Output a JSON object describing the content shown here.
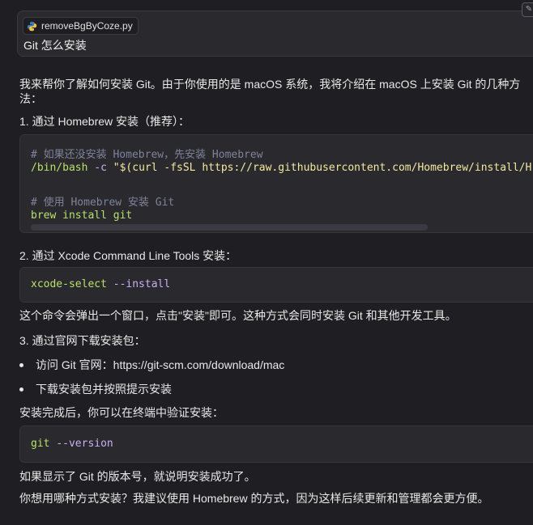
{
  "user_message": {
    "file_name": "removeBgByCoze.py",
    "text": "Git 怎么安装"
  },
  "response": {
    "intro_line1": "我来帮你了解如何安装 Git。由于你使用的是 macOS 系统，我将介绍在 macOS 上安装 Git 的几种方",
    "intro_line2": "法：",
    "method1_title": "1. 通过 Homebrew 安装（推荐）：",
    "code1": {
      "comment1": "# 如果还没安装 Homebrew，先安装 Homebrew",
      "line2_cmd": "/bin/bash",
      "line2_flag": "-c",
      "line2_str": "\"$(curl -fsSL https://raw.githubusercontent.com/Homebrew/install/H",
      "comment2": "# 使用 Homebrew 安装 Git",
      "line4_cmd": "brew install git"
    },
    "method2_title": "2. 通过 Xcode Command Line Tools 安装：",
    "code2": {
      "cmd": "xcode-select",
      "flag": "--install"
    },
    "method2_desc": "这个命令会弹出一个窗口，点击\"安装\"即可。这种方式会同时安装 Git 和其他开发工具。",
    "method3_title": "3. 通过官网下载安装包：",
    "bullets": [
      "访问 Git 官网：https://git-scm.com/download/mac",
      "下载安装包并按照提示安装"
    ],
    "verify_text": "安装完成后，你可以在终端中验证安装：",
    "code3": {
      "cmd": "git",
      "flag": "--version"
    },
    "success_text": "如果显示了 Git 的版本号，就说明安装成功了。",
    "closing_text": "你想用哪种方式安装？我建议使用 Homebrew 的方式，因为这样后续更新和管理都会更方便。"
  },
  "icons": {
    "file": "python-file-icon",
    "edit": "edit-icon"
  },
  "colors": {
    "background": "#1f1f23",
    "code_bg": "#2a2a2e",
    "command": "#b7e06a",
    "comment": "#7f8399",
    "string": "#f2e8a0"
  }
}
